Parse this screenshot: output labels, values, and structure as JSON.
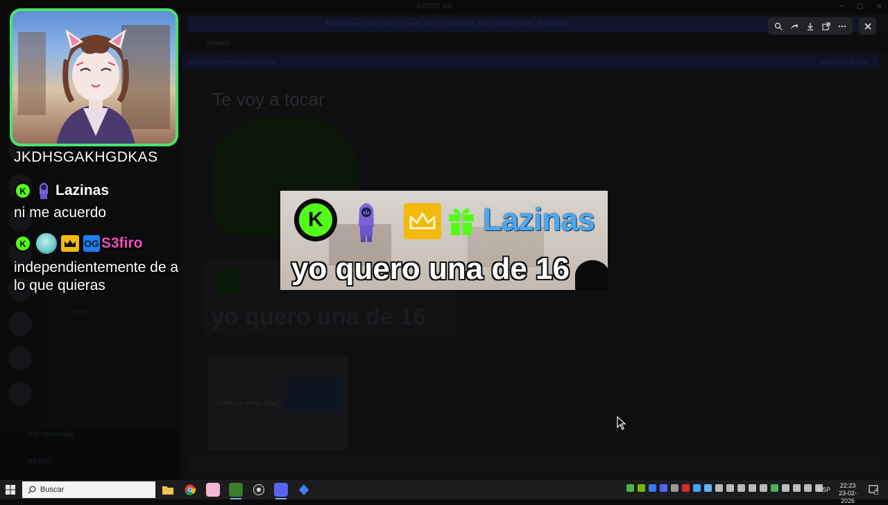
{
  "background_app": {
    "title": "ASTRO ela",
    "banner": "Desbloquear Nitro por 2 meses con tu cuenta de Xbox Game Pass · Reclamar",
    "channel": "memes",
    "notice_left": "Está viendo mensajes antiguos",
    "notice_right": "Saltar a lo actual",
    "message_title": "Te voy a tocar",
    "ghost_image_text": "yo quero una de 16",
    "meme_caption": "¿Puedo ver memes Edge?",
    "voice_status": "Voz conectada",
    "username": "ASTRO"
  },
  "image_viewer": {
    "toolbar_icons": [
      "zoom-icon",
      "share-icon",
      "download-icon",
      "open-external-icon",
      "more-icon"
    ],
    "close_icon": "close-icon"
  },
  "viewed_image": {
    "username": "Lazinas",
    "message": "yo quero una de 16",
    "k_letter": "K"
  },
  "stream_overlay": {
    "cam_user": "JKDHSGAKHGDKAS",
    "chat": [
      {
        "username": "Lazinas",
        "text": "ni me acuerdo",
        "name_color": "#ffffff"
      },
      {
        "username": "S3firo",
        "text": "independientemente de a lo que quieras",
        "name_color": "#f24fc2",
        "badge_text": "OG"
      }
    ],
    "k_letter": "K"
  },
  "taskbar": {
    "search_placeholder": "Buscar",
    "language": "ESP",
    "time": "22:23",
    "date": "23-02-2026",
    "notification_count": "2"
  },
  "colors": {
    "kick_green": "#53fc18",
    "frame_green": "#4be36b",
    "name_blue": "#4aa9f0",
    "crown_gold": "#f2b90f",
    "pink_name": "#f24fc2"
  }
}
